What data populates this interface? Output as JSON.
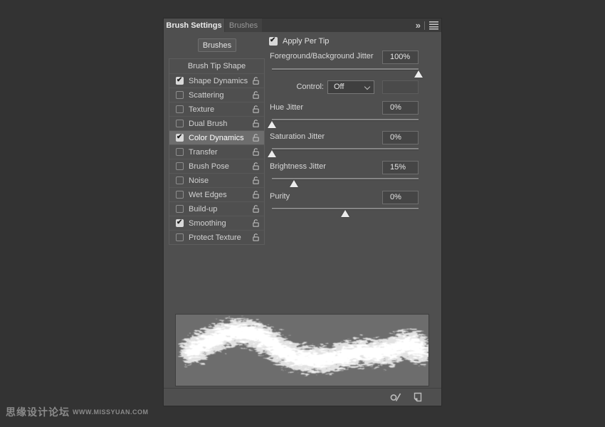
{
  "panel": {
    "tabs": [
      {
        "label": "Brush Settings",
        "active": true
      },
      {
        "label": "Brushes",
        "active": false
      }
    ],
    "strip_icons": {
      "collapse": "»"
    },
    "brushes_button_label": "Brushes",
    "sidebar": {
      "header": "Brush Tip Shape",
      "items": [
        {
          "label": "Shape Dynamics",
          "checked": true,
          "selected": false
        },
        {
          "label": "Scattering",
          "checked": false,
          "selected": false
        },
        {
          "label": "Texture",
          "checked": false,
          "selected": false
        },
        {
          "label": "Dual Brush",
          "checked": false,
          "selected": false
        },
        {
          "label": "Color Dynamics",
          "checked": true,
          "selected": true
        },
        {
          "label": "Transfer",
          "checked": false,
          "selected": false
        },
        {
          "label": "Brush Pose",
          "checked": false,
          "selected": false
        },
        {
          "label": "Noise",
          "checked": false,
          "selected": false
        },
        {
          "label": "Wet Edges",
          "checked": false,
          "selected": false
        },
        {
          "label": "Build-up",
          "checked": false,
          "selected": false
        },
        {
          "label": "Smoothing",
          "checked": true,
          "selected": false
        },
        {
          "label": "Protect Texture",
          "checked": false,
          "selected": false
        }
      ]
    },
    "controls": {
      "apply_per_tip": {
        "label": "Apply Per Tip",
        "checked": true
      },
      "fg_bg_jitter": {
        "label": "Foreground/Background Jitter",
        "value": "100%",
        "thumb_pct": 100
      },
      "control": {
        "label": "Control:",
        "value": "Off"
      },
      "hue_jitter": {
        "label": "Hue Jitter",
        "value": "0%",
        "thumb_pct": 0
      },
      "saturation_jitter": {
        "label": "Saturation Jitter",
        "value": "0%",
        "thumb_pct": 0
      },
      "brightness_jitter": {
        "label": "Brightness Jitter",
        "value": "15%",
        "thumb_pct": 15
      },
      "purity": {
        "label": "Purity",
        "value": "0%",
        "thumb_pct": 50
      }
    }
  },
  "watermark": {
    "site_name": "思缘设计论坛",
    "url": "WWW.MISSYUAN.COM"
  },
  "colors": {
    "page_bg": "#333333",
    "panel_bg": "#4f4f4f",
    "tabstrip_bg": "#3a3a3a",
    "selected_row_bg": "#6d6d6d",
    "preview_bg": "#6d6d6d",
    "stroke_color": "#ffffff"
  }
}
